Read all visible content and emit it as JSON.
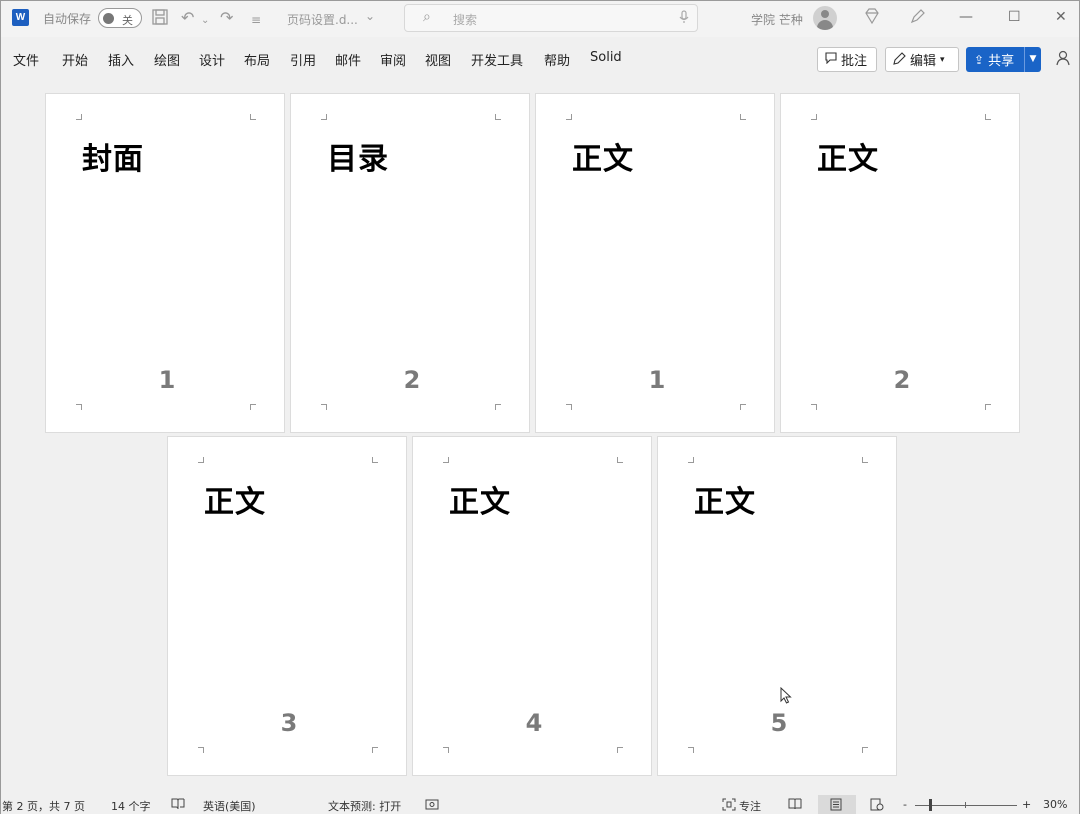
{
  "titlebar": {
    "app_icon_letter": "W",
    "autosave_label": "自动保存",
    "autosave_state": "关",
    "doc_name": "页码设置.d...",
    "search_placeholder": "搜索",
    "user_name": "学院 芒种",
    "icons": [
      "word-icon",
      "save-icon",
      "undo-icon",
      "redo-icon",
      "customize-icon",
      "search-icon",
      "mic-icon",
      "diamond-icon",
      "pen-icon",
      "minimize-icon",
      "maximize-icon",
      "close-icon"
    ]
  },
  "menu": {
    "items": [
      "文件",
      "开始",
      "插入",
      "绘图",
      "设计",
      "布局",
      "引用",
      "邮件",
      "审阅",
      "视图",
      "开发工具",
      "帮助",
      "Solid"
    ],
    "comment_label": "批注",
    "edit_label": "编辑",
    "share_label": "共享"
  },
  "pages": [
    {
      "heading": "封面",
      "number": "1"
    },
    {
      "heading": "目录",
      "number": "2"
    },
    {
      "heading": "正文",
      "number": "1"
    },
    {
      "heading": "正文",
      "number": "2"
    },
    {
      "heading": "正文",
      "number": "3"
    },
    {
      "heading": "正文",
      "number": "4"
    },
    {
      "heading": "正文",
      "number": "5"
    }
  ],
  "status": {
    "page_info": "第 2 页，共 7 页",
    "word_count": "14 个字",
    "language": "英语(美国)",
    "text_prediction": "文本预测: 打开",
    "focus_label": "专注",
    "zoom_minus": "-",
    "zoom_plus": "+",
    "zoom_level": "30%",
    "zoom_fraction": 0.3
  }
}
